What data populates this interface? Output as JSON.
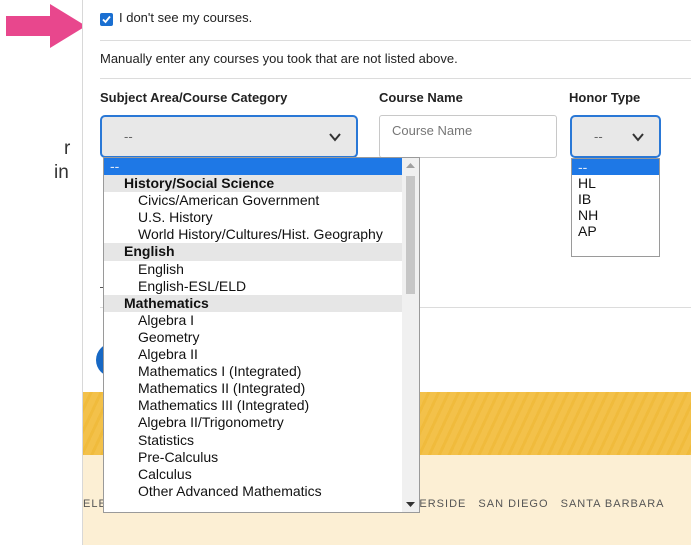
{
  "fragments": {
    "left_text_1": "r",
    "left_text_2": "in"
  },
  "colors": {
    "accent": "#1e78e6",
    "arrow": "#e8478d",
    "footer": "#f3c14a"
  },
  "checkbox": {
    "checked": true,
    "label": "I don't see my courses."
  },
  "instructions": "Manually enter any courses you took that are not listed above.",
  "columns": {
    "subject": "Subject Area/Course Category",
    "course": "Course Name",
    "honor": "Honor Type"
  },
  "subject_select": {
    "value": "--"
  },
  "course_input": {
    "placeholder": "Course Name",
    "value": ""
  },
  "honor_select": {
    "value": "--"
  },
  "honor_options": [
    "--",
    "HL",
    "IB",
    "NH",
    "AP"
  ],
  "subject_options": [
    {
      "type": "selected",
      "label": "--"
    },
    {
      "type": "group",
      "label": "History/Social Science"
    },
    {
      "type": "option",
      "label": "Civics/American Government"
    },
    {
      "type": "option",
      "label": "U.S. History"
    },
    {
      "type": "option",
      "label": "World History/Cultures/Hist. Geography"
    },
    {
      "type": "group",
      "label": "English"
    },
    {
      "type": "option",
      "label": "English"
    },
    {
      "type": "option",
      "label": "English-ESL/ELD"
    },
    {
      "type": "group",
      "label": "Mathematics"
    },
    {
      "type": "option",
      "label": "Algebra I"
    },
    {
      "type": "option",
      "label": "Geometry"
    },
    {
      "type": "option",
      "label": "Algebra II"
    },
    {
      "type": "option",
      "label": "Mathematics I (Integrated)"
    },
    {
      "type": "option",
      "label": "Mathematics II (Integrated)"
    },
    {
      "type": "option",
      "label": "Mathematics III (Integrated)"
    },
    {
      "type": "option",
      "label": "Algebra II/Trigonometry"
    },
    {
      "type": "option",
      "label": "Statistics"
    },
    {
      "type": "option",
      "label": "Pre-Calculus"
    },
    {
      "type": "option",
      "label": "Calculus"
    },
    {
      "type": "option",
      "label": "Other Advanced Mathematics"
    }
  ],
  "footer": {
    "campus_partial": "ELE",
    "campuses": [
      "IVERSIDE",
      "SAN DIEGO",
      "SANTA BARBARA"
    ]
  }
}
